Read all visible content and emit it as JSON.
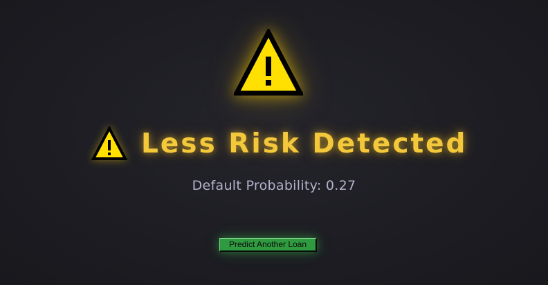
{
  "result": {
    "icon": "warning-triangle-icon",
    "headline": "Less Risk Detected",
    "probability_text": "Default Probability: 0.27",
    "probability": 0.27
  },
  "actions": {
    "predict_again_label": "Predict Another Loan"
  },
  "colors": {
    "background": "#1d1d23",
    "warning_fill": "#ffe000",
    "warning_stroke": "#000000",
    "headline": "#f3c83a",
    "probability_text": "#b4b2cc",
    "button": "#2f9a3f"
  }
}
